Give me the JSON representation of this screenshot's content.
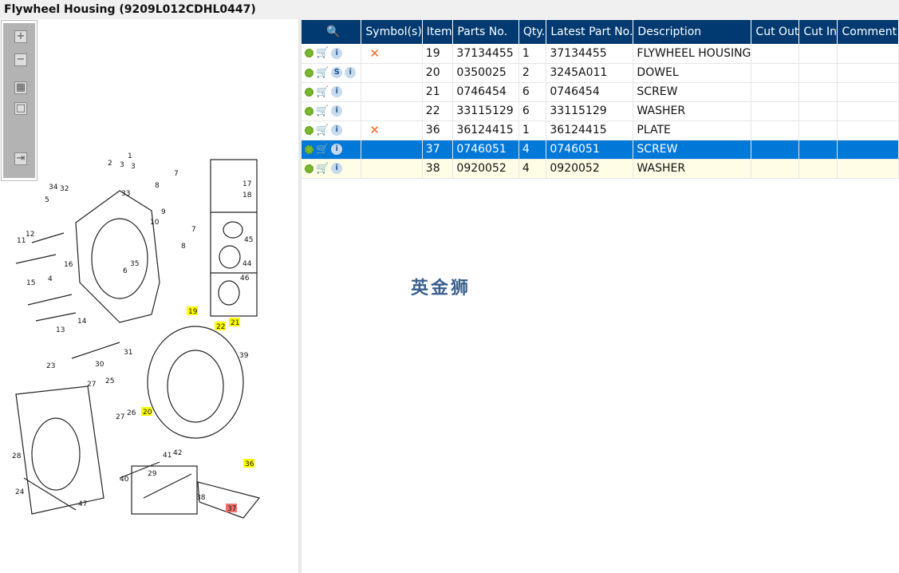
{
  "title": "Flywheel Housing (9209L012CDHL0447)",
  "toolbar": {
    "zoom_in": "+",
    "zoom_out": "−",
    "fit": "▦",
    "actual": "□",
    "export": "⇥"
  },
  "grid": {
    "headers": [
      "",
      "Symbol(s)",
      "Item",
      "Parts No.",
      "Qty.",
      "Latest Part No.",
      "Description",
      "Cut Out",
      "Cut In",
      "Comment"
    ],
    "rows": [
      {
        "icons": [
          "gear",
          "cart",
          "info"
        ],
        "symbol": "✕",
        "item": "19",
        "part": "37134455",
        "qty": "1",
        "latest": "37134455",
        "desc": "FLYWHEEL HOUSING",
        "cut_out": "",
        "cut_in": "",
        "comment": ""
      },
      {
        "icons": [
          "gear",
          "cart",
          "s",
          "info"
        ],
        "symbol": "",
        "item": "20",
        "part": "0350025",
        "qty": "2",
        "latest": "3245A011",
        "desc": "DOWEL",
        "cut_out": "",
        "cut_in": "",
        "comment": ""
      },
      {
        "icons": [
          "gear",
          "cart",
          "info"
        ],
        "symbol": "",
        "item": "21",
        "part": "0746454",
        "qty": "6",
        "latest": "0746454",
        "desc": "SCREW",
        "cut_out": "",
        "cut_in": "",
        "comment": ""
      },
      {
        "icons": [
          "gear",
          "cart",
          "info"
        ],
        "symbol": "",
        "item": "22",
        "part": "33115129",
        "qty": "6",
        "latest": "33115129",
        "desc": "WASHER",
        "cut_out": "",
        "cut_in": "",
        "comment": ""
      },
      {
        "icons": [
          "gear",
          "cart",
          "info"
        ],
        "symbol": "✕",
        "item": "36",
        "part": "36124415",
        "qty": "1",
        "latest": "36124415",
        "desc": "PLATE",
        "cut_out": "",
        "cut_in": "",
        "comment": ""
      },
      {
        "icons": [
          "gear",
          "cart",
          "info"
        ],
        "symbol": "",
        "item": "37",
        "part": "0746051",
        "qty": "4",
        "latest": "0746051",
        "desc": "SCREW",
        "cut_out": "",
        "cut_in": "",
        "comment": "",
        "selected": true
      },
      {
        "icons": [
          "gear",
          "cart",
          "info"
        ],
        "symbol": "",
        "item": "38",
        "part": "0920052",
        "qty": "4",
        "latest": "0920052",
        "desc": "WASHER",
        "cut_out": "",
        "cut_in": "",
        "comment": "",
        "alt": true
      }
    ]
  },
  "watermark": "英金狮",
  "diagram": {
    "callouts": [
      "1",
      "2",
      "3",
      "3",
      "7",
      "8",
      "34",
      "32",
      "33",
      "17",
      "18",
      "5",
      "9",
      "10",
      "12",
      "7",
      "8",
      "45",
      "11",
      "16",
      "35",
      "6",
      "44",
      "4",
      "46",
      "15",
      "14",
      "13",
      "19",
      "22",
      "21",
      "31",
      "39",
      "30",
      "23",
      "27",
      "25",
      "20",
      "26",
      "27",
      "28",
      "41",
      "42",
      "36",
      "40",
      "29",
      "24",
      "38",
      "47",
      "37"
    ],
    "highlighted": [
      "19",
      "22",
      "21",
      "20",
      "36"
    ],
    "selected": "37"
  }
}
